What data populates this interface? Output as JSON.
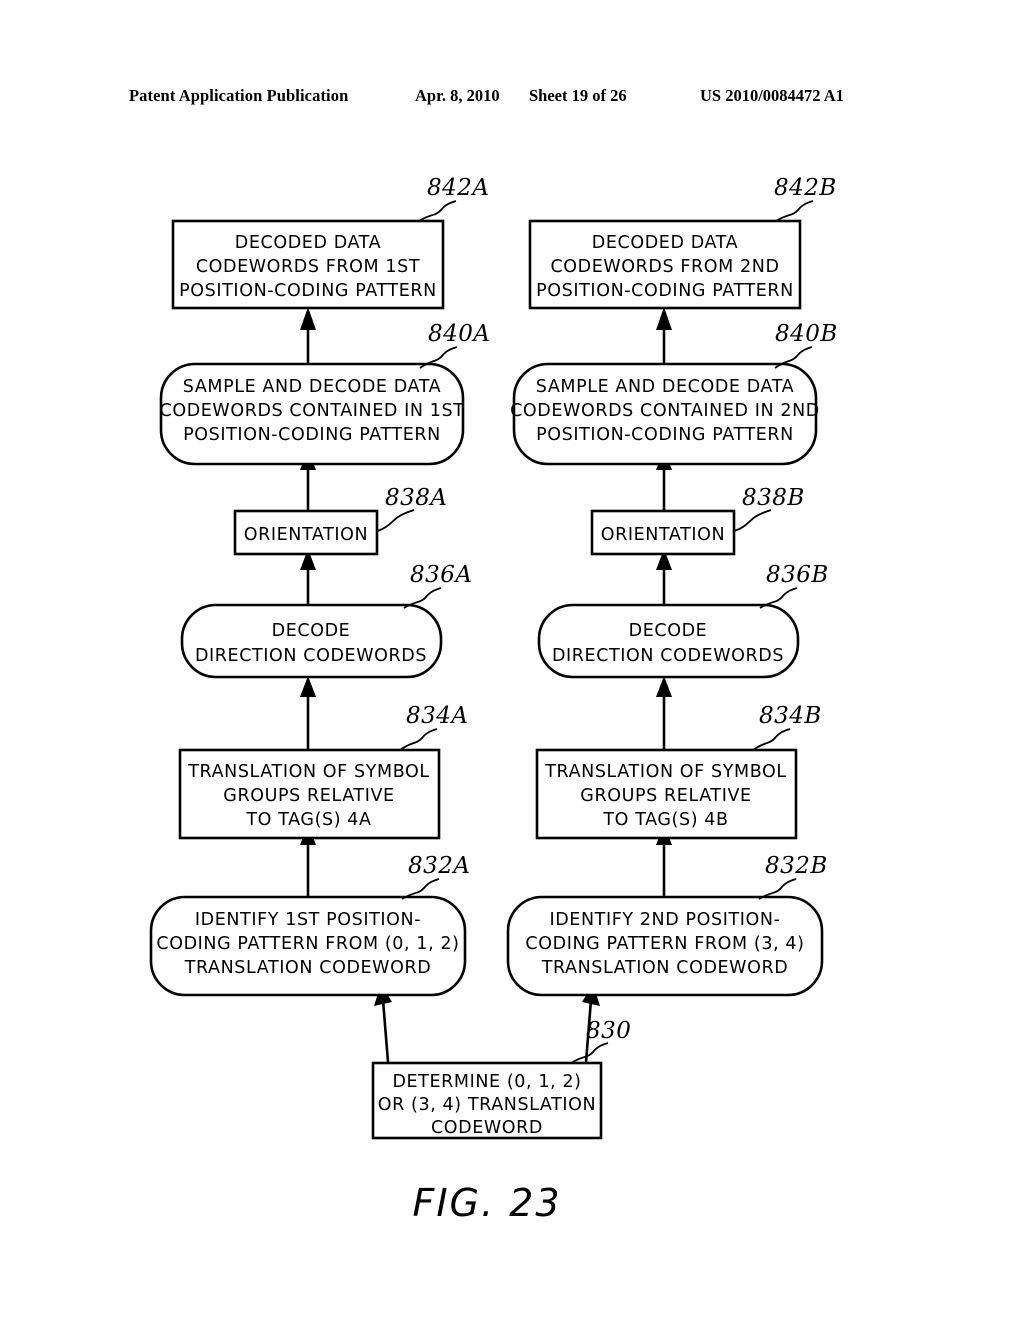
{
  "header": {
    "publication": "Patent Application Publication",
    "date": "Apr. 8, 2010",
    "sheet": "Sheet 19 of 26",
    "number": "US 2010/0084472 A1"
  },
  "figure": {
    "caption": "FIG. 23"
  },
  "diagram": {
    "type": "flowchart",
    "nodes": [
      {
        "id": "842A",
        "ref": "842A",
        "shape": "rectangle",
        "column": "left",
        "lines": [
          "DECODED DATA",
          "CODEWORDS FROM 1ST",
          "POSITION-CODING PATTERN"
        ]
      },
      {
        "id": "842B",
        "ref": "842B",
        "shape": "rectangle",
        "column": "right",
        "lines": [
          "DECODED DATA",
          "CODEWORDS FROM 2ND",
          "POSITION-CODING PATTERN"
        ]
      },
      {
        "id": "840A",
        "ref": "840A",
        "shape": "rounded",
        "column": "left",
        "lines": [
          "SAMPLE AND DECODE DATA",
          "CODEWORDS CONTAINED IN 1ST",
          "POSITION-CODING PATTERN"
        ]
      },
      {
        "id": "840B",
        "ref": "840B",
        "shape": "rounded",
        "column": "right",
        "lines": [
          "SAMPLE AND DECODE DATA",
          "CODEWORDS CONTAINED IN 2ND",
          "POSITION-CODING PATTERN"
        ]
      },
      {
        "id": "838A",
        "ref": "838A",
        "shape": "rectangle",
        "column": "left",
        "lines": [
          "ORIENTATION"
        ]
      },
      {
        "id": "838B",
        "ref": "838B",
        "shape": "rectangle",
        "column": "right",
        "lines": [
          "ORIENTATION"
        ]
      },
      {
        "id": "836A",
        "ref": "836A",
        "shape": "rounded",
        "column": "left",
        "lines": [
          "DECODE",
          "DIRECTION CODEWORDS"
        ]
      },
      {
        "id": "836B",
        "ref": "836B",
        "shape": "rounded",
        "column": "right",
        "lines": [
          "DECODE",
          "DIRECTION CODEWORDS"
        ]
      },
      {
        "id": "834A",
        "ref": "834A",
        "shape": "rectangle",
        "column": "left",
        "lines": [
          "TRANSLATION OF SYMBOL",
          "GROUPS RELATIVE",
          "TO TAG(S) 4A"
        ]
      },
      {
        "id": "834B",
        "ref": "834B",
        "shape": "rectangle",
        "column": "right",
        "lines": [
          "TRANSLATION OF SYMBOL",
          "GROUPS RELATIVE",
          "TO TAG(S) 4B"
        ]
      },
      {
        "id": "832A",
        "ref": "832A",
        "shape": "rounded",
        "column": "left",
        "lines": [
          "IDENTIFY 1ST POSITION-",
          "CODING PATTERN FROM (0, 1, 2)",
          "TRANSLATION CODEWORD"
        ]
      },
      {
        "id": "832B",
        "ref": "832B",
        "shape": "rounded",
        "column": "right",
        "lines": [
          "IDENTIFY 2ND POSITION-",
          "CODING PATTERN FROM (3, 4)",
          "TRANSLATION CODEWORD"
        ]
      },
      {
        "id": "830",
        "ref": "830",
        "shape": "rectangle",
        "column": "center",
        "lines": [
          "DETERMINE (0, 1, 2)",
          "OR (3, 4) TRANSLATION",
          "CODEWORD"
        ]
      }
    ],
    "edges": [
      {
        "from": "830",
        "to": "832A",
        "style": "diagonal-arrow"
      },
      {
        "from": "830",
        "to": "832B",
        "style": "diagonal-arrow"
      },
      {
        "from": "832A",
        "to": "834A",
        "style": "vertical-arrow"
      },
      {
        "from": "834A",
        "to": "836A",
        "style": "vertical-arrow"
      },
      {
        "from": "836A",
        "to": "838A",
        "style": "vertical-arrow"
      },
      {
        "from": "838A",
        "to": "840A",
        "style": "vertical-arrow"
      },
      {
        "from": "840A",
        "to": "842A",
        "style": "vertical-arrow"
      },
      {
        "from": "832B",
        "to": "834B",
        "style": "vertical-arrow"
      },
      {
        "from": "834B",
        "to": "836B",
        "style": "vertical-arrow"
      },
      {
        "from": "836B",
        "to": "838B",
        "style": "vertical-arrow"
      },
      {
        "from": "838B",
        "to": "840B",
        "style": "vertical-arrow"
      },
      {
        "from": "840B",
        "to": "842B",
        "style": "vertical-arrow"
      }
    ],
    "colors": {
      "stroke": "#000000",
      "fill": "#ffffff",
      "text": "#000000"
    }
  }
}
